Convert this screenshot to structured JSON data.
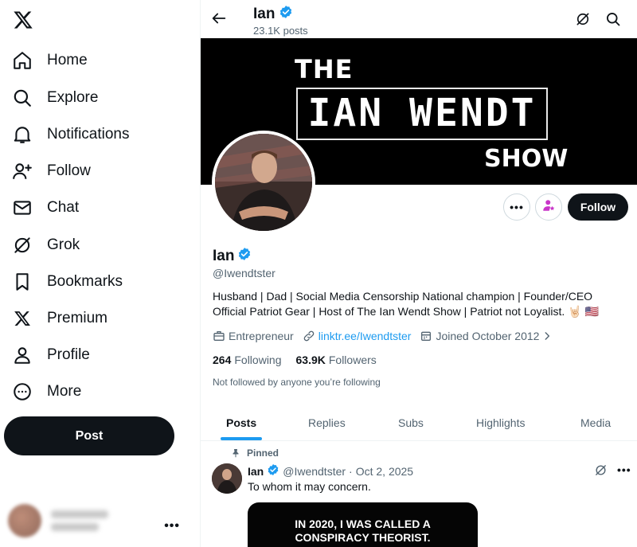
{
  "sidebar": {
    "logo": "x-logo-icon",
    "items": [
      {
        "label": "Home",
        "icon": "home-icon"
      },
      {
        "label": "Explore",
        "icon": "search-icon"
      },
      {
        "label": "Notifications",
        "icon": "bell-icon"
      },
      {
        "label": "Follow",
        "icon": "follow-icon"
      },
      {
        "label": "Chat",
        "icon": "mail-icon"
      },
      {
        "label": "Grok",
        "icon": "grok-icon"
      },
      {
        "label": "Bookmarks",
        "icon": "bookmark-icon"
      },
      {
        "label": "Premium",
        "icon": "x-logo-icon"
      },
      {
        "label": "Profile",
        "icon": "person-icon"
      },
      {
        "label": "More",
        "icon": "more-circle-icon"
      }
    ],
    "post_label": "Post",
    "account_more": "•••"
  },
  "header": {
    "name": "Ian",
    "post_count": "23.1K posts"
  },
  "banner": {
    "line1": "THE",
    "line2": "IAN WENDT",
    "line3": "SHOW"
  },
  "profile": {
    "name": "Ian",
    "handle": "@Iwendtster",
    "bio": "Husband | Dad | Social Media Censorship National champion | Founder/CEO Official Patriot Gear | Host of The Ian Wendt Show | Patriot not Loyalist. 🤘🏻 🇺🇸",
    "profession": "Entrepreneur",
    "link": "linktr.ee/Iwendtster",
    "joined": "Joined October 2012",
    "following_count": "264",
    "following_label": "Following",
    "followers_count": "63.9K",
    "followers_label": "Followers",
    "not_followed": "Not followed by anyone you’re following",
    "follow_button": "Follow",
    "more_button": "•••"
  },
  "tabs": [
    "Posts",
    "Replies",
    "Subs",
    "Highlights",
    "Media"
  ],
  "post": {
    "pinned_label": "Pinned",
    "name": "Ian",
    "handle": "@Iwendtster",
    "separator": "·",
    "date": "Oct 2, 2025",
    "text": "To whom it may concern.",
    "media_text_1": "IN 2020, I WAS CALLED A",
    "media_text_2": "CONSPIRACY THEORIST.",
    "more": "•••"
  },
  "colors": {
    "accent": "#1d9bf0",
    "verified": "#1d9bf0",
    "text": "#0f1419",
    "secondary": "#536471",
    "subscribe": "#c936c9"
  }
}
